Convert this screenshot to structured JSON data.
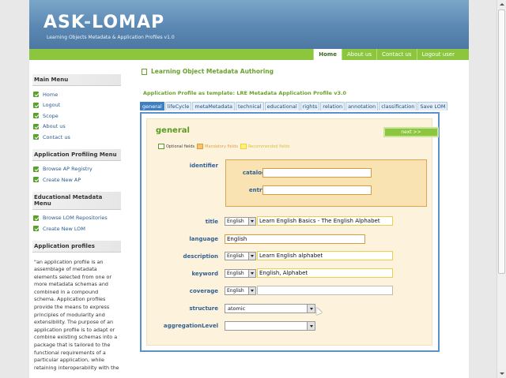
{
  "header": {
    "logo_prefix": "ASK",
    "logo_dash": "-",
    "logo_suffix": "LOMAP",
    "tagline": "Learning Objects Metadata & Application Profiles v1.0"
  },
  "nav": {
    "items": [
      {
        "label": "Home",
        "active": true
      },
      {
        "label": "About us"
      },
      {
        "label": "Contact us"
      },
      {
        "label": "Logout user"
      }
    ]
  },
  "sidebar": {
    "main_menu": {
      "title": "Main Menu",
      "items": [
        "Home",
        "Logout",
        "Scope",
        "About us",
        "Contact us"
      ]
    },
    "ap_menu": {
      "title": "Application Profiling Menu",
      "items": [
        "Browse AP Registry",
        "Create New AP"
      ]
    },
    "edu_menu": {
      "title": "Educational Metadata Menu",
      "items": [
        "Browse LOM Repositories",
        "Create New LOM"
      ]
    },
    "ap_info": {
      "title": "Application profiles",
      "text": "\"an application profile is an assemblage of metadata elements selected from one or more metadata schemas and combined in a compound schema. Application profiles provide the means to express principles of modularity and extensibility. The purpose of an application profile is to adapt or combine existing schemas into a package that is tailored to the functional requirements of a particular application, while retaining interoperability with the"
    }
  },
  "main": {
    "title": "Learning Object Metadata Authoring",
    "subtitle": "Application Profile as template: LRE Metadata Application Profile v3.0",
    "tabs": [
      "general",
      "lifeCycle",
      "metaMetadata",
      "technical",
      "educational",
      "rights",
      "relation",
      "annotation",
      "classification",
      "Save LOM"
    ],
    "section_title": "general",
    "next_label": "next >>",
    "legend": {
      "optional": "Optional fields",
      "mandatory": "Mandatory fields",
      "recommended": "Recommended fields"
    },
    "fields": {
      "identifier": "identifier",
      "catalog": "catalog",
      "entry": "entry",
      "title": "title",
      "title_lang": "English",
      "title_value": "Learn English Basics - The English Alphabet",
      "language": "language",
      "language_value": "English",
      "description": "description",
      "description_lang": "English",
      "description_value": "Learn English alphabet",
      "keyword": "keyword",
      "keyword_lang": "English",
      "keyword_value": "English, Alphabet",
      "coverage": "coverage",
      "coverage_lang": "English",
      "structure": "structure",
      "structure_value": "atomic",
      "aggregationLevel": "aggregationLevel"
    }
  },
  "colors": {
    "accent_green": "#8cc63f",
    "link_blue": "#2f5f94",
    "mandatory": "#f9e3b3",
    "recommended": "#fff9b0"
  }
}
